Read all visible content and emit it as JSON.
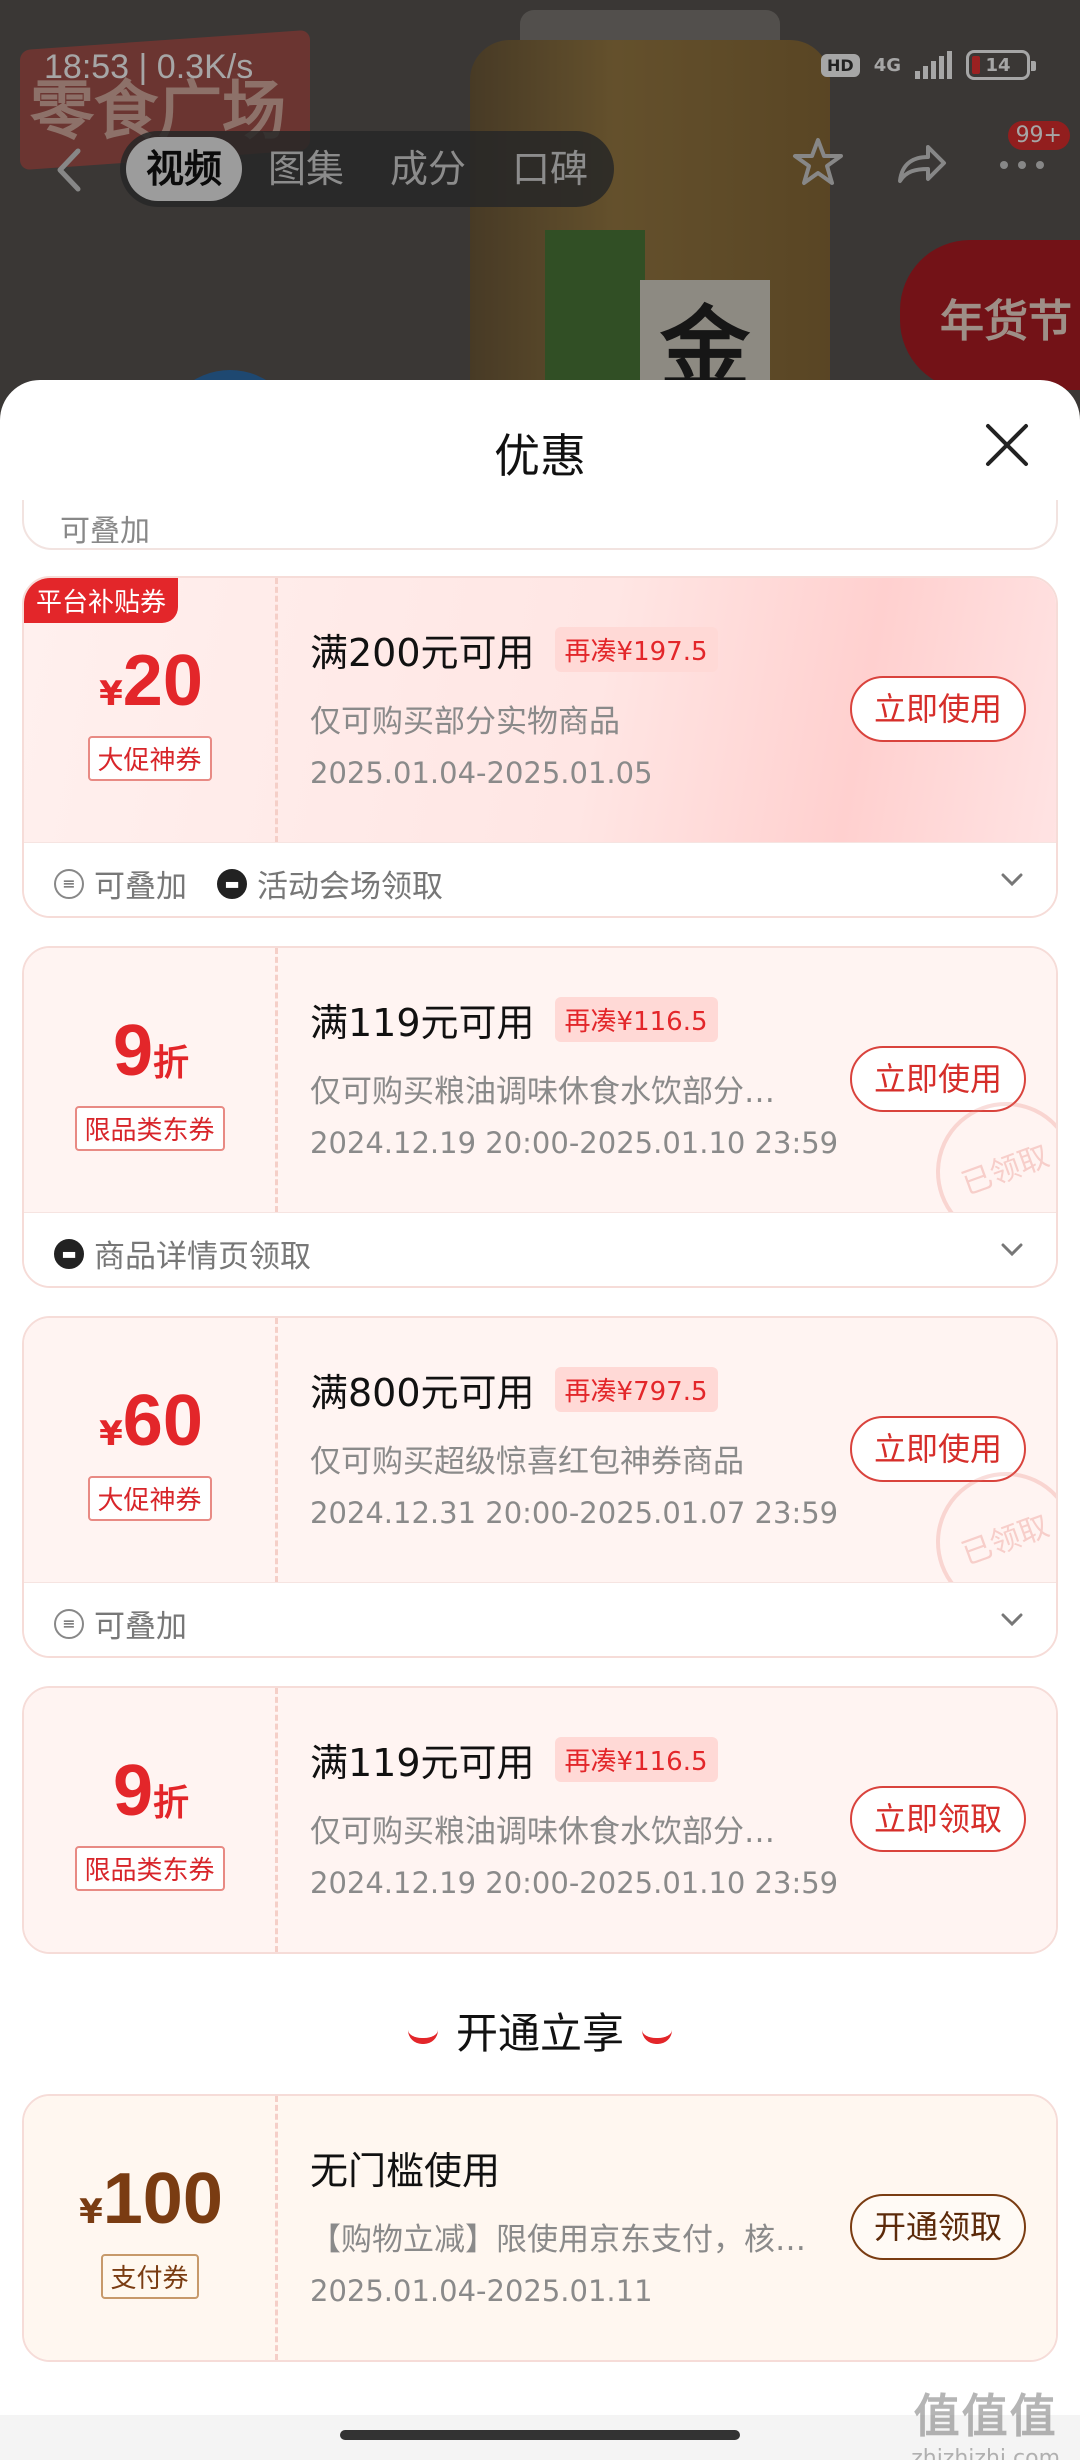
{
  "status_bar": {
    "time": "18:53 | 0.3K/s",
    "hd": "HD",
    "network": "4G",
    "battery": "14"
  },
  "background": {
    "banner_text": "零食广场",
    "label_char": "金",
    "badge_text": "年货节",
    "tabs": [
      "视频",
      "图集",
      "成分",
      "口碑"
    ],
    "active_tab": 0,
    "notif_count": "99+"
  },
  "sheet": {
    "title": "优惠",
    "partial_tag": "可叠加"
  },
  "coupons": [
    {
      "corner": "平台补贴券",
      "currency": "¥",
      "amount": "20",
      "unit": "",
      "type": "大促神券",
      "condition": "满200元可用",
      "gap": "再凑¥197.5",
      "desc": "仅可购买部分实物商品",
      "date": "2025.01.04-2025.01.05",
      "button": "立即使用",
      "tags": [
        "可叠加",
        "活动会场领取"
      ]
    },
    {
      "currency": "",
      "amount": "9",
      "unit": "折",
      "type": "限品类东券",
      "condition": "满119元可用",
      "gap": "再凑¥116.5",
      "desc": "仅可购买粮油调味休食水饮部分…",
      "date": "2024.12.19 20:00-2025.01.10 23:59",
      "button": "立即使用",
      "stamp": "已领取",
      "tags": [
        "商品详情页领取"
      ]
    },
    {
      "currency": "¥",
      "amount": "60",
      "unit": "",
      "type": "大促神券",
      "condition": "满800元可用",
      "gap": "再凑¥797.5",
      "desc": "仅可购买超级惊喜红包神券商品",
      "date": "2024.12.31 20:00-2025.01.07 23:59",
      "button": "立即使用",
      "stamp": "已领取",
      "tags": [
        "可叠加"
      ]
    },
    {
      "currency": "",
      "amount": "9",
      "unit": "折",
      "type": "限品类东券",
      "condition": "满119元可用",
      "gap": "再凑¥116.5",
      "desc": "仅可购买粮油调味休食水饮部分…",
      "date": "2024.12.19 20:00-2025.01.10 23:59",
      "button": "立即领取"
    }
  ],
  "section": {
    "title": "开通立享"
  },
  "pay_coupon": {
    "currency": "¥",
    "amount": "100",
    "type": "支付券",
    "condition": "无门槛使用",
    "desc": "【购物立减】限使用京东支付，核…",
    "date": "2025.01.04-2025.01.11",
    "button": "开通领取"
  },
  "watermark": {
    "big": "值值值",
    "small": "zhizhizhi.com"
  }
}
